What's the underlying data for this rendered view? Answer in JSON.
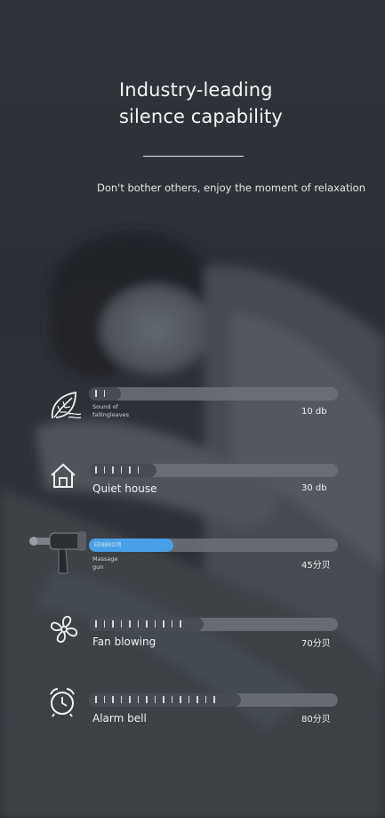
{
  "headline": {
    "line1": "Industry-leading",
    "line2": "silence capability"
  },
  "subline": "Don't bother others, enjoy the moment of relaxation",
  "levels": [
    {
      "label": "Sound of fallingleaves",
      "label_line1": "Sound of",
      "label_line2": "fallingleaves",
      "value": "10 db",
      "icon": "leaf-icon",
      "fill": 0.13,
      "ticks": 2
    },
    {
      "label": "Quiet house",
      "value": "30 db",
      "icon": "house-icon",
      "fill": 0.27,
      "ticks": 6
    },
    {
      "label": "Massage gun",
      "label_line1": "Massage",
      "label_line2": "gun",
      "value": "45分贝",
      "icon": "massage-gun-icon",
      "fill": 0.34,
      "bar_text": "EE8B8公司",
      "highlight": "#4aa0e8"
    },
    {
      "label": "Fan blowing",
      "value": "70分贝",
      "icon": "fan-icon",
      "fill": 0.46,
      "ticks": 11
    },
    {
      "label": "Alarm bell",
      "value": "80分贝",
      "icon": "alarm-clock-icon",
      "fill": 0.61,
      "ticks": 15
    }
  ]
}
